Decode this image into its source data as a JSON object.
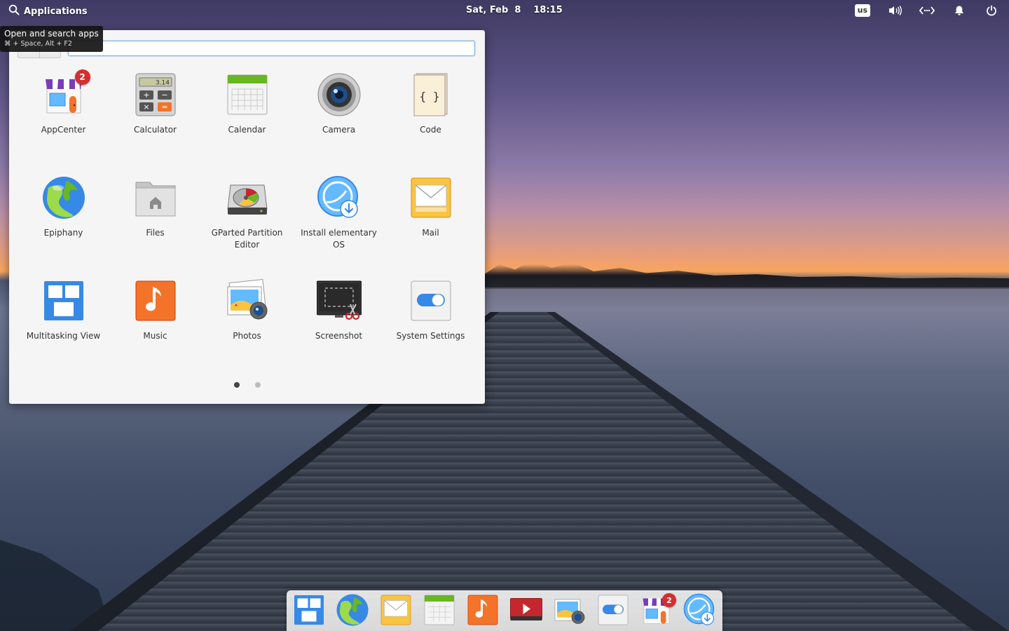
{
  "panel": {
    "applications_label": "Applications",
    "date": "Sat, Feb  8",
    "time": "18:15",
    "keyboard_layout": "us"
  },
  "tooltip": {
    "title": "Open and search apps",
    "shortcut": "⌘ + Space, Alt + F2"
  },
  "launcher": {
    "search": {
      "value": "",
      "placeholder": ""
    },
    "apps": [
      {
        "label": "AppCenter",
        "badge": "2"
      },
      {
        "label": "Calculator",
        "display": "3.14"
      },
      {
        "label": "Calendar"
      },
      {
        "label": "Camera"
      },
      {
        "label": "Code",
        "glyph": "{ }"
      },
      {
        "label": "Epiphany"
      },
      {
        "label": "Files"
      },
      {
        "label": "GParted Partition Editor"
      },
      {
        "label": "Install elementary OS"
      },
      {
        "label": "Mail"
      },
      {
        "label": "Multitasking View"
      },
      {
        "label": "Music"
      },
      {
        "label": "Photos"
      },
      {
        "label": "Screenshot"
      },
      {
        "label": "System Settings"
      }
    ],
    "pages": {
      "current": 1,
      "total": 2
    }
  },
  "dock": {
    "items": [
      {
        "icon": "multitasking-icon"
      },
      {
        "icon": "epiphany-icon"
      },
      {
        "icon": "mail-icon"
      },
      {
        "icon": "calendar-icon"
      },
      {
        "icon": "music-icon"
      },
      {
        "icon": "videos-icon"
      },
      {
        "icon": "photos-icon"
      },
      {
        "icon": "system-settings-icon"
      },
      {
        "icon": "appcenter-icon",
        "badge": "2"
      },
      {
        "icon": "installer-icon"
      }
    ]
  },
  "colors": {
    "accent": "#3689e6",
    "badge": "#d42f2f",
    "music": "#f37329",
    "calendar_header": "#68b723"
  }
}
